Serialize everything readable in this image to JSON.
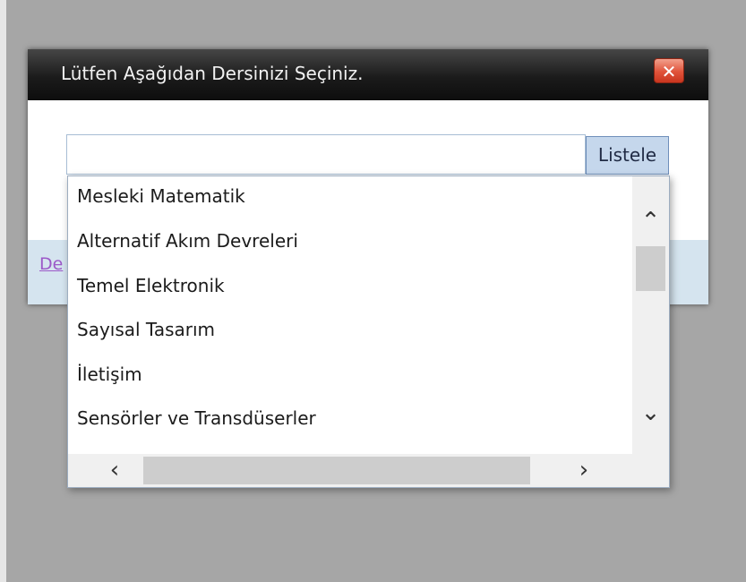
{
  "dialog": {
    "title": "Lütfen Aşağıdan Dersinizi Seçiniz.",
    "close_glyph": "✕",
    "footer_link_text": "De"
  },
  "search": {
    "value": "",
    "placeholder": "",
    "button_label": "Listele"
  },
  "list": {
    "items": [
      "Mesleki Matematik",
      "Alternatif Akım Devreleri",
      "Temel Elektronik",
      "Sayısal Tasarım",
      "İletişim",
      "Sensörler ve Transdüserler"
    ]
  },
  "scrollbar": {
    "up_icon": "⌃",
    "down_icon": "⌄",
    "left_icon": "‹",
    "right_icon": "›"
  },
  "colors": {
    "titlebar": "#1b1b1b",
    "close_button": "#e0533a",
    "list_button": "#c5d7ec",
    "footer_band": "#d5e4ef",
    "backdrop": "#a6a6a6"
  }
}
